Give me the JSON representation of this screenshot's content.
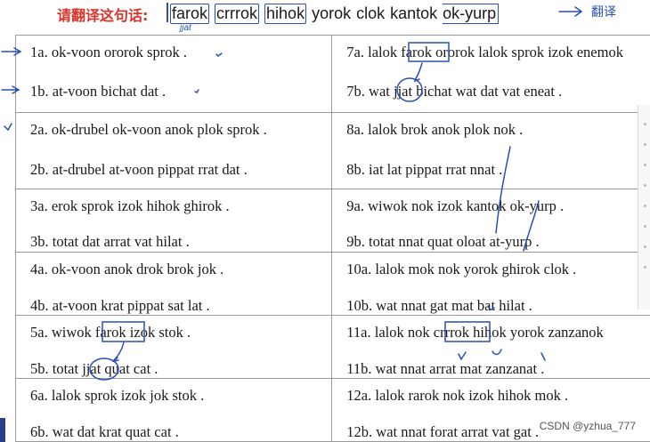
{
  "header": {
    "prompt": "请翻译这句话:",
    "sentence_words": [
      "farok",
      "crrrok",
      "hihok",
      "yorok",
      "clok",
      "kantok",
      "ok-yurp"
    ]
  },
  "table": {
    "rows": [
      {
        "left": {
          "a": "1a. ok-voon ororok sprok .",
          "b": "1b. at-voon bichat dat ."
        },
        "right": {
          "a": "7a. lalok farok ororok lalok sprok izok enemok",
          "b": "7b. wat jjat bichat wat dat vat eneat ."
        }
      },
      {
        "left": {
          "a": "2a. ok-drubel ok-voon anok plok sprok .",
          "b": "2b. at-drubel at-voon pippat rrat dat ."
        },
        "right": {
          "a": "8a. lalok brok anok plok nok .",
          "b": "8b. iat lat pippat rrat nnat ."
        }
      },
      {
        "left": {
          "a": "3a. erok sprok izok hihok ghirok .",
          "b": "3b. totat dat arrat vat hilat ."
        },
        "right": {
          "a": "9a. wiwok nok izok kantok ok-yurp .",
          "b": "9b. totat nnat quat oloat at-yurp ."
        }
      },
      {
        "left": {
          "a": "4a. ok-voon anok drok brok jok .",
          "b": "4b. at-voon krat pippat sat lat ."
        },
        "right": {
          "a": "10a. lalok mok nok yorok ghirok clok .",
          "b": "10b. wat nnat gat mat bat hilat ."
        }
      },
      {
        "left": {
          "a": "5a. wiwok farok izok stok .",
          "b": "5b. totat jjat quat cat ."
        },
        "right": {
          "a": "11a. lalok nok crrrok hihok yorok zanzanok",
          "b": "11b. wat nnat arrat mat zanzanat ."
        }
      },
      {
        "left": {
          "a": "6a. lalok sprok izok jok stok .",
          "b": "6b. wat dat krat quat cat ."
        },
        "right": {
          "a": "12a. lalok rarok nok izok hihok mok .",
          "b": "12b. wat nnat forat arrat vat gat ."
        }
      }
    ]
  },
  "handwriting": {
    "under_farok": "jjat",
    "after_sentence": "翻译"
  },
  "watermark": "CSDN @yzhua_777",
  "colors": {
    "prompt_red": "#d9342b",
    "ink_blue": "#2a4fb5",
    "grid": "#9a9a9a"
  }
}
